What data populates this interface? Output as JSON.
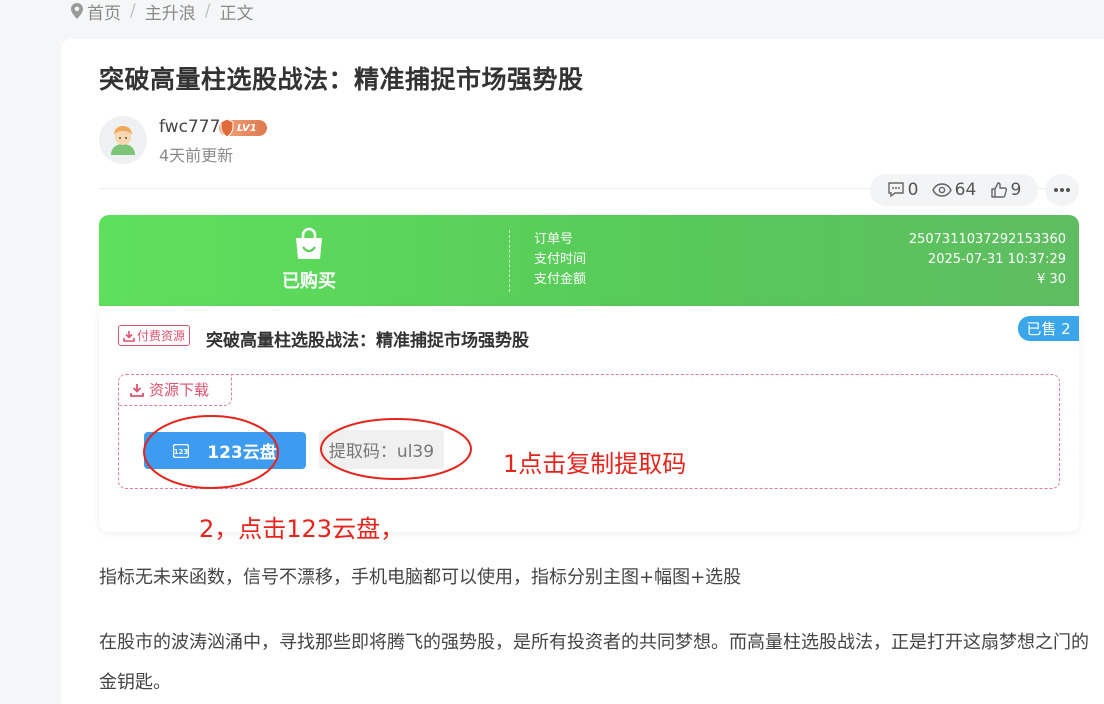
{
  "breadcrumb": {
    "items": [
      "首页",
      "主升浪",
      "正文"
    ],
    "sep": "/"
  },
  "article": {
    "title": "突破高量柱选股战法：精准捕捉市场强势股",
    "author": "fwc777",
    "level": "LV1",
    "updated": "4天前更新"
  },
  "stats": {
    "comments": "0",
    "views": "64",
    "likes": "9"
  },
  "order": {
    "status": "已购买",
    "labels": [
      "订单号",
      "支付时间",
      "支付金额"
    ],
    "values": [
      "2507311037292153360",
      "2025-07-31 10:37:29",
      "¥ 30"
    ]
  },
  "resource": {
    "tag": "付费资源",
    "title": "突破高量柱选股战法：精准捕捉市场强势股",
    "sold": "已售 2",
    "download_tab": "资源下载",
    "cloud_button": "123云盘",
    "code": "提取码：ul39"
  },
  "annotations": {
    "note1": "1点击复制提取码",
    "note2": "2，点击123云盘，",
    "color": "#e8231b"
  },
  "body": {
    "p1": "指标无未来函数，信号不漂移，手机电脑都可以使用，指标分别主图+幅图+选股",
    "p2": "在股市的波涛汹涌中，寻找那些即将腾飞的强势股，是所有投资者的共同梦想。而高量柱选股战法，正是打开这扇梦想之门的金钥匙。"
  },
  "colors": {
    "green_start": "#5fe05c",
    "green_end": "#5fbd61",
    "blue_button": "#3d9bf0",
    "pink": "#e0516e",
    "sold_blue": "#3ba7ea"
  }
}
